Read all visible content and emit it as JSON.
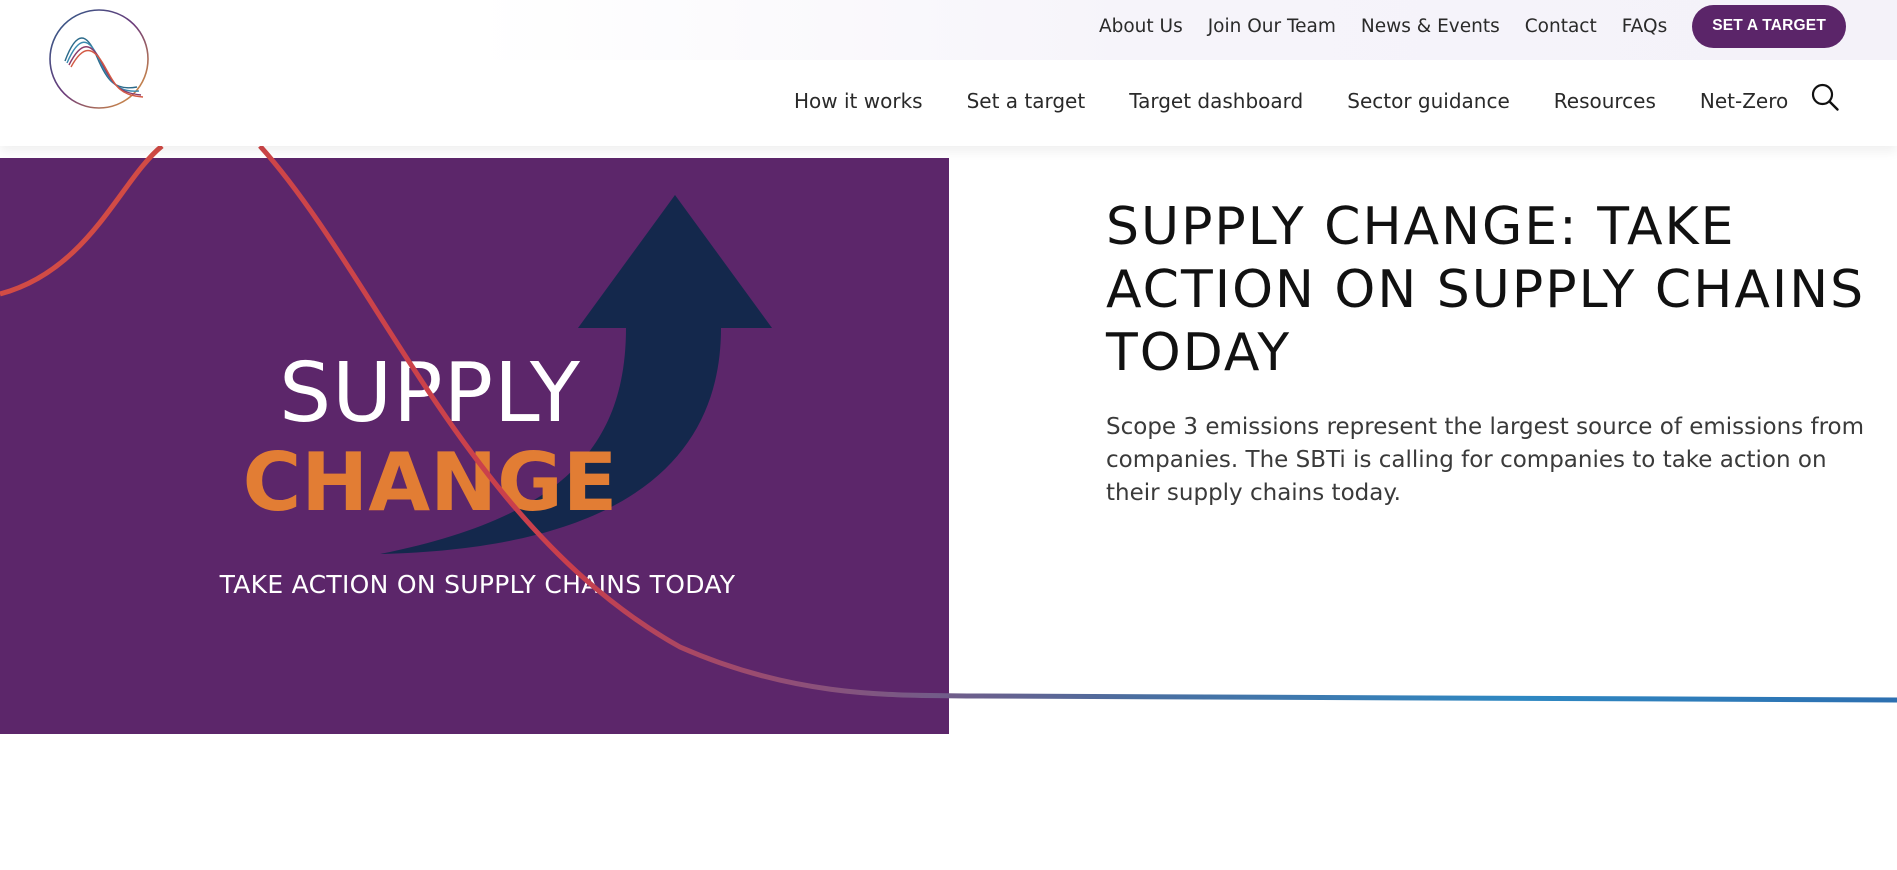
{
  "brand": {
    "accent": "#5b2569",
    "orange": "#e27d34",
    "navy": "#14284c"
  },
  "header": {
    "logo_icon": "sbti-wave-logo",
    "utility_nav": [
      "About Us",
      "Join Our Team",
      "News & Events",
      "Contact",
      "FAQs"
    ],
    "cta_label": "SET A TARGET",
    "main_nav": [
      "How it works",
      "Set a target",
      "Target dashboard",
      "Sector guidance",
      "Resources",
      "Net-Zero"
    ],
    "search_icon": "search-icon"
  },
  "hero": {
    "banner": {
      "line1": "SUPPLY",
      "line2": "CHANGE",
      "tagline": "TAKE ACTION ON SUPPLY CHAINS TODAY",
      "background": "#5c266a"
    },
    "heading": "SUPPLY CHANGE: TAKE ACTION ON SUPPLY CHAINS TODAY",
    "description": "Scope 3 emissions represent the largest source of emissions from companies. The SBTi is calling for companies to take action on their supply chains today."
  }
}
